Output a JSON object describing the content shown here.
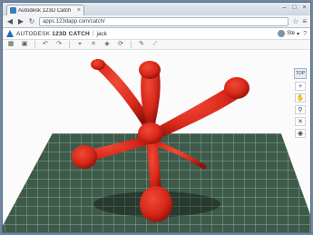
{
  "browser": {
    "tab_title": "Autodesk 123D Catch",
    "tab_close": "×",
    "window_buttons": [
      "–",
      "□",
      "×"
    ],
    "url": "apps.123dapp.com/catch/"
  },
  "app": {
    "brand": "AUTODESK",
    "product": "123D CATCH",
    "separator": "|",
    "document_name": "jack",
    "user_name": "Ste",
    "help": "?"
  },
  "toolbar": {
    "icons": [
      "grid-icon",
      "save-icon",
      "undo-icon",
      "redo-icon",
      "select-icon",
      "crop-icon",
      "layers-icon",
      "refresh-icon",
      "share-icon",
      "measure-icon"
    ]
  },
  "viewport": {
    "model_color": "#d8281a",
    "mat_color": "#3e5a4a",
    "nav_cube_label": "TOP",
    "nav_tools": [
      "zoom-icon",
      "pan-icon",
      "search-icon",
      "fit-icon",
      "eye-icon"
    ]
  }
}
